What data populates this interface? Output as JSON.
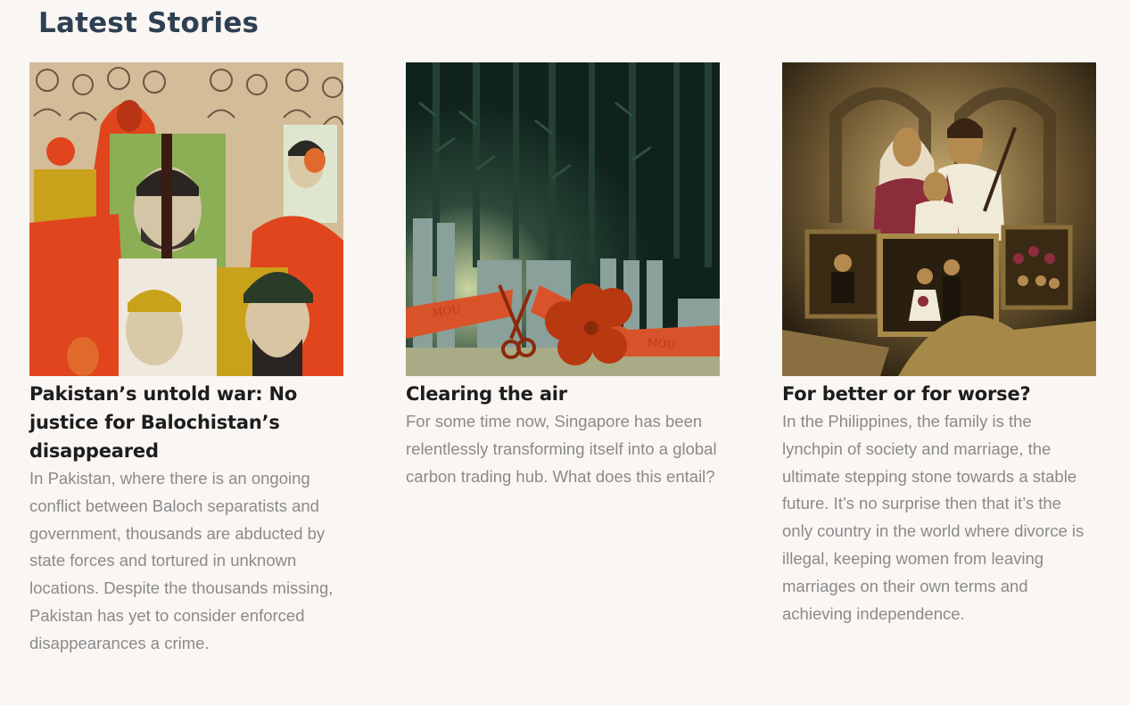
{
  "section": {
    "title": "Latest Stories"
  },
  "stories": [
    {
      "title": "Pakistan’s untold war: No justice for Balochistan’s disappeared",
      "description": "In Pakistan, where there is an ongoing conflict between Baloch separatists and government, thousands are abducted by state forces and tortured in unknown locations. Despite the thousands missing, Pakistan has yet to consider enforced disappearances a crime.",
      "image": "protest-crowd-illustration"
    },
    {
      "title": "Clearing the air",
      "description": "For some time now, Singapore has been relentlessly transforming itself into a global carbon trading hub. What does this entail?",
      "image": "ribbon-cutting-forest-illustration",
      "ribbon_text": "MOU"
    },
    {
      "title": "For better or for worse?",
      "description": "In the Philippines, the family is the lynchpin of society and marriage, the ultimate stepping stone towards a stable future. It’s no surprise then that it’s the only country in the world where divorce is illegal, keeping women from leaving marriages on their own terms and achieving independence.",
      "image": "family-portrait-illustration"
    }
  ],
  "colors": {
    "background": "#faf6f3",
    "heading": "#2e3f52",
    "title": "#1d1d1d",
    "body": "#8a8a8a"
  }
}
